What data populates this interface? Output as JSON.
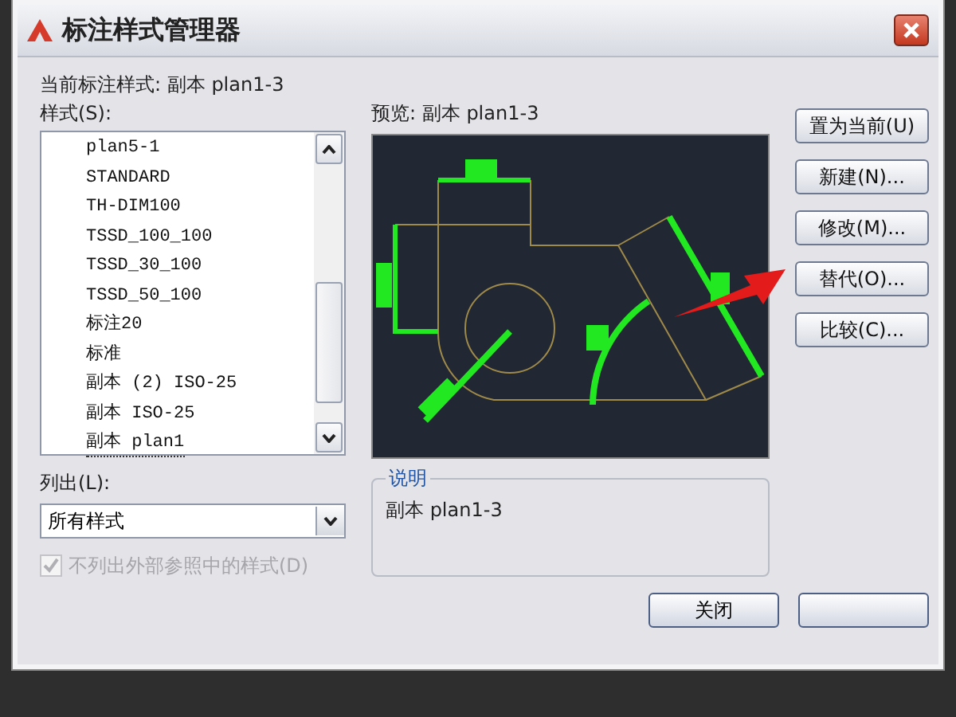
{
  "window": {
    "title": "标注样式管理器"
  },
  "current_style": {
    "label": "当前标注样式:",
    "value": "副本 plan1-3"
  },
  "styles": {
    "label": "样式(S):",
    "items": [
      {
        "name": "plan5-1",
        "focused": false
      },
      {
        "name": "STANDARD",
        "focused": false
      },
      {
        "name": "TH-DIM100",
        "focused": false
      },
      {
        "name": "TSSD_100_100",
        "focused": false
      },
      {
        "name": "TSSD_30_100",
        "focused": false
      },
      {
        "name": "TSSD_50_100",
        "focused": false
      },
      {
        "name": "标注20",
        "focused": false
      },
      {
        "name": "标准",
        "focused": false
      },
      {
        "name": "副本 (2) ISO-25",
        "focused": false
      },
      {
        "name": "副本 ISO-25",
        "focused": false
      },
      {
        "name": "副本 plan1",
        "focused": true
      }
    ]
  },
  "list_filter": {
    "label": "列出(L):",
    "value": "所有样式"
  },
  "checkbox": {
    "label": "不列出外部参照中的样式(D)",
    "checked": true,
    "disabled": true
  },
  "preview": {
    "label": "预览:",
    "value": "副本 plan1-3"
  },
  "description": {
    "legend": "说明",
    "text": "副本 plan1-3"
  },
  "side_buttons": [
    "置为当前(U)",
    "新建(N)...",
    "修改(M)...",
    "替代(O)...",
    "比较(C)..."
  ],
  "bottom_buttons": [
    "关闭"
  ]
}
